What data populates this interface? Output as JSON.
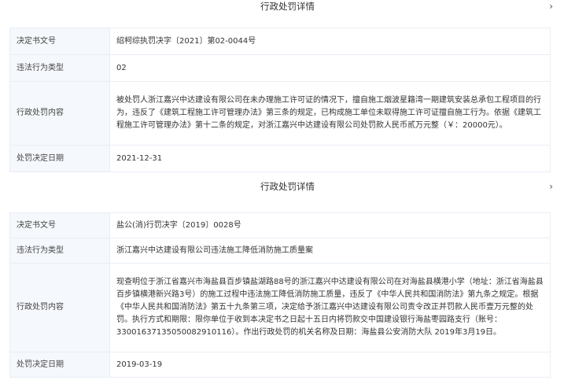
{
  "panels": [
    {
      "title": "行政处罚详情",
      "chevron": "›",
      "rows": [
        {
          "label": "决定书文号",
          "value": "绍柯综执罚决字〔2021〕第02-0044号"
        },
        {
          "label": "违法行为类型",
          "value": "02"
        },
        {
          "label": "行政处罚内容",
          "value": "被处罚人浙江嘉兴中达建设有限公司在未办理施工许可证的情况下，擅自施工烟波星籍湾一期建筑安装总承包工程项目的行为，违反了《建筑工程施工许可管理办法》第三条的规定，已构成施工单位未取得施工许可证擅自施工行为。依据《建筑工程施工许可管理办法》第十二条的规定，对浙江嘉兴中达建设有限公司处罚款人民币贰万元整（￥：20000元）。"
        },
        {
          "label": "处罚决定日期",
          "value": "2021-12-31"
        }
      ]
    },
    {
      "title": "行政处罚详情",
      "chevron": "›",
      "rows": [
        {
          "label": "决定书文号",
          "value": "盐公(消)行罚决字〔2019〕0028号"
        },
        {
          "label": "违法行为类型",
          "value": "浙江嘉兴中达建设有限公司违法施工降低消防施工质量案"
        },
        {
          "label": "行政处罚内容",
          "value": "现查明位于浙江省嘉兴市海盐县百步镇盐湖路88号的浙江嘉兴中达建设有限公司在对海盐县横港小学（地址：浙江省海盐县百步镇横港新兴路3号）的施工过程中违法施工降低消防施工质量，违反了《中华人民共和国消防法》第九条之规定。根据《中华人民共和国消防法》第五十九条第三项，决定给予浙江嘉兴中达建设有限公司责令改正并罚款人民币壹万元整的处罚。执行方式和期限：限你单位于收到本决定书之日起十五日内将罚款交中国建设银行海盐枣园路支行（账号：33001637135050082910116）。作出行政处罚的机关名称及日期：海盐县公安消防大队 2019年3月19日。"
        },
        {
          "label": "处罚决定日期",
          "value": "2019-03-19"
        }
      ]
    }
  ]
}
